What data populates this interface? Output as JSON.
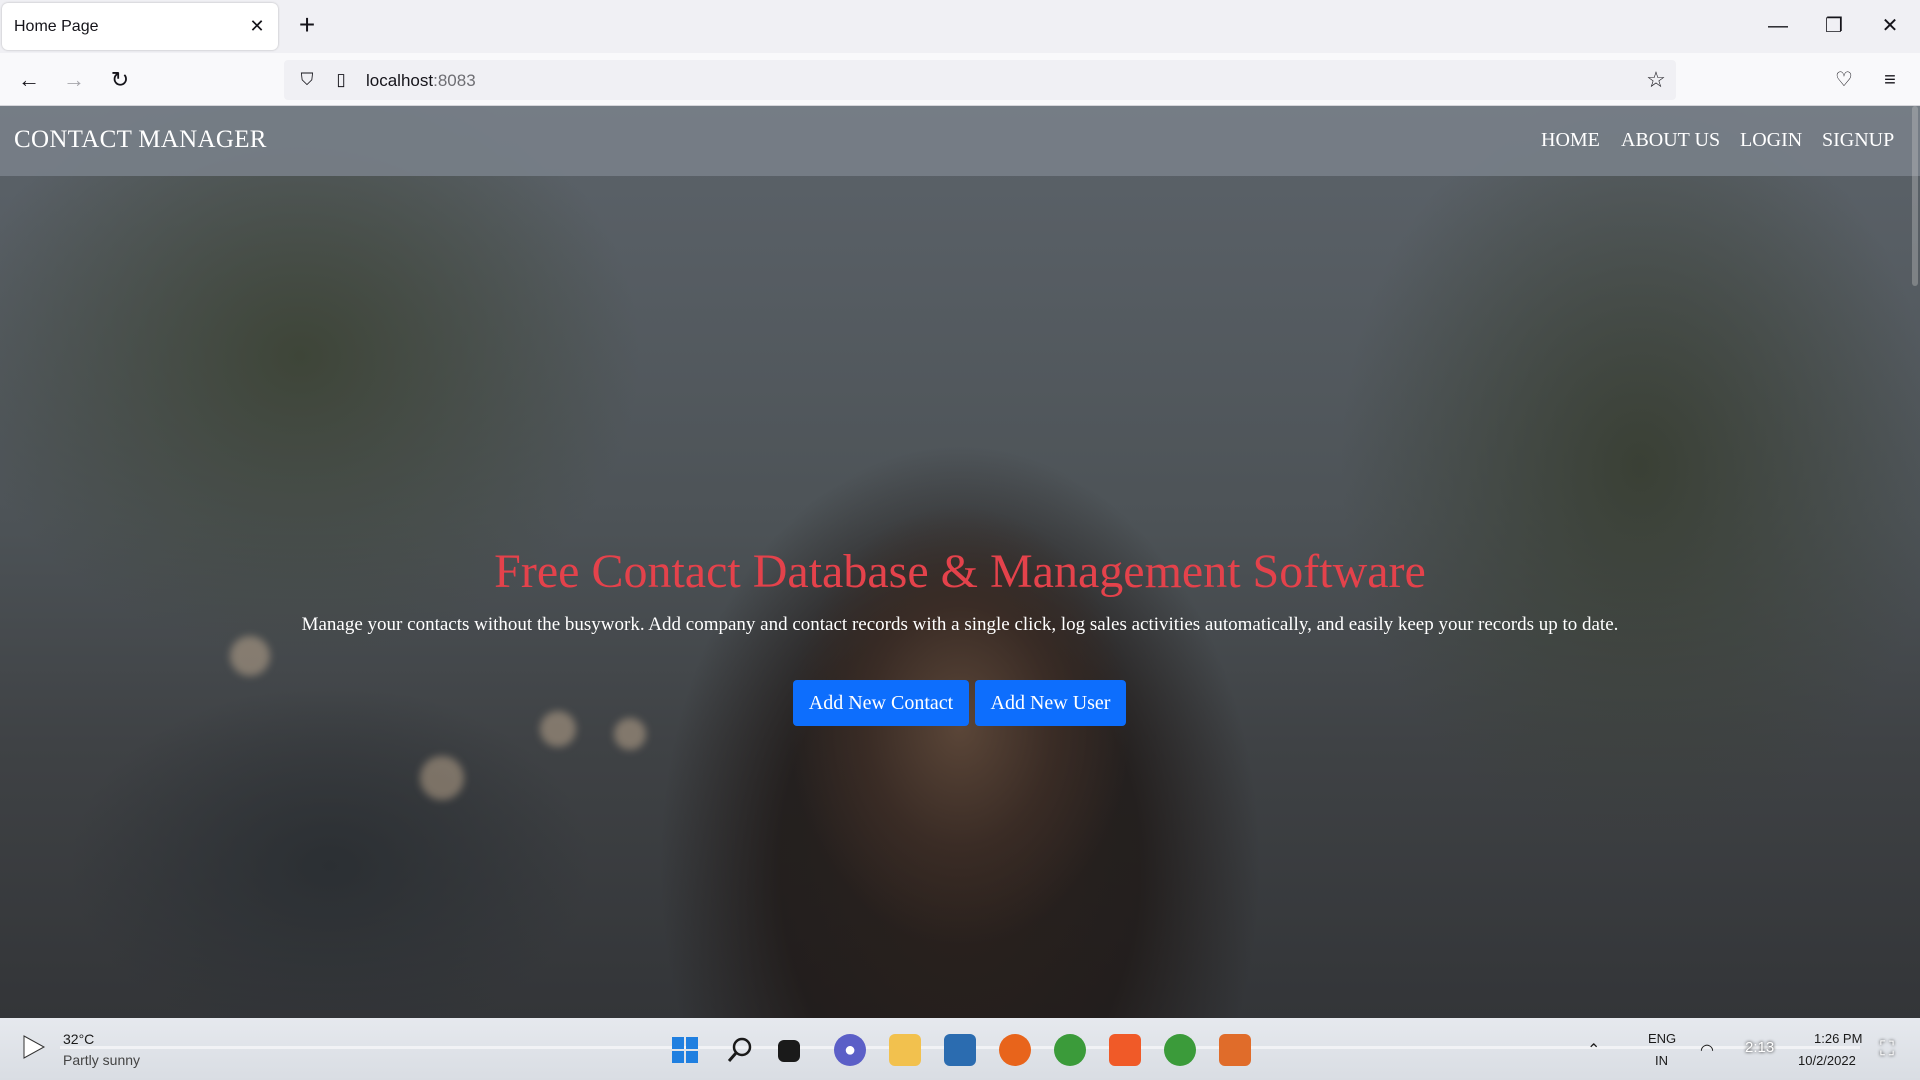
{
  "browser": {
    "tab_title": "Home Page",
    "url_host": "localhost",
    "url_port": ":8083"
  },
  "site": {
    "brand": "CONTACT MANAGER",
    "nav": [
      "HOME",
      "ABOUT US",
      "LOGIN",
      "SIGNUP"
    ]
  },
  "hero": {
    "title": "Free Contact Database & Management Software",
    "subtitle": "Manage your contacts without the busywork. Add company and contact records with a single click, log sales activities automatically, and easily keep your records up to date.",
    "buttons": [
      "Add New Contact",
      "Add New User"
    ]
  },
  "taskbar": {
    "weather_temp": "32°C",
    "weather_desc": "Partly sunny",
    "lang_top": "ENG",
    "lang_bottom": "IN",
    "clock_time": "1:26 PM",
    "clock_date": "10/2/2022"
  },
  "video": {
    "elapsed": "2:13",
    "progress": 0.0
  },
  "colors": {
    "hero_title": "#e4424b",
    "button": "#0d6efd",
    "site_nav": "#788088"
  },
  "icons": [
    "back-arrow-icon",
    "forward-arrow-icon",
    "reload-icon",
    "shield-icon",
    "page-icon",
    "star-icon",
    "pocket-icon",
    "hamburger-menu-icon",
    "play-icon",
    "windows-start-icon",
    "search-icon"
  ]
}
